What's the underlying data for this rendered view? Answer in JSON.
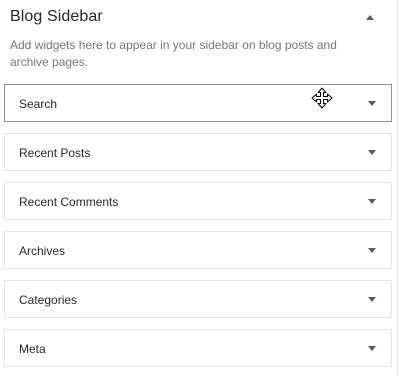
{
  "sidebar": {
    "title": "Blog Sidebar",
    "description": "Add widgets here to appear in your sidebar on blog posts and archive pages."
  },
  "widgets": [
    {
      "label": "Search"
    },
    {
      "label": "Recent Posts"
    },
    {
      "label": "Recent Comments"
    },
    {
      "label": "Archives"
    },
    {
      "label": "Categories"
    },
    {
      "label": "Meta"
    }
  ],
  "icons": {
    "collapse": "triangle-up-icon",
    "expand": "triangle-down-icon",
    "cursor": "move-cursor-icon"
  },
  "colors": {
    "text": "#23282d",
    "description": "#72777c",
    "border": "#e5e5e5",
    "active_border": "#8c8f94",
    "arrow": "#555d66"
  }
}
